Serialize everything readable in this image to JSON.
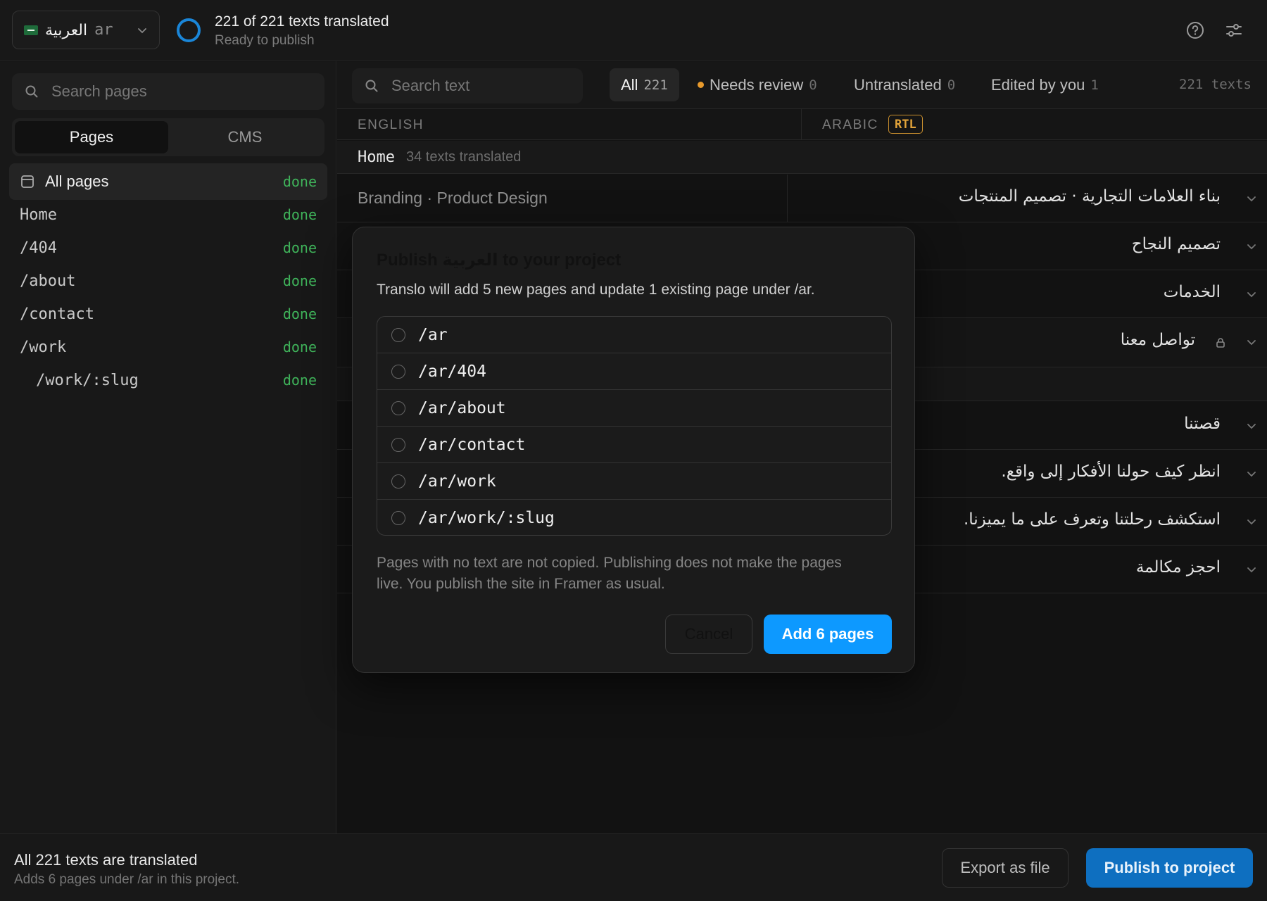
{
  "header": {
    "language_name": "العربية",
    "language_code": "ar",
    "status_title": "221 of 221 texts translated",
    "status_sub": "Ready to publish",
    "icons": [
      "help-icon",
      "settings-sliders-icon"
    ]
  },
  "sidebar": {
    "search_placeholder": "Search pages",
    "tabs": [
      "Pages",
      "CMS"
    ],
    "active_tab": "Pages",
    "items": [
      {
        "label": "All pages",
        "status": "done"
      },
      {
        "label": "Home",
        "status": "done"
      },
      {
        "label": "/404",
        "status": "done"
      },
      {
        "label": "/about",
        "status": "done"
      },
      {
        "label": "/contact",
        "status": "done"
      },
      {
        "label": "/work",
        "status": "done"
      },
      {
        "label": "/work/:slug",
        "status": "done"
      }
    ]
  },
  "filters": {
    "search_placeholder": "Search text",
    "chips": [
      {
        "label": "All",
        "count": "221"
      },
      {
        "label": "Needs review",
        "count": "0"
      },
      {
        "label": "Untranslated",
        "count": "0"
      },
      {
        "label": "Edited by you",
        "count": "1"
      }
    ],
    "total": "221 texts"
  },
  "columns": {
    "source": "ENGLISH",
    "target": "ARABIC",
    "badge": "RTL"
  },
  "section": {
    "name": "Home",
    "meta": "34 texts translated"
  },
  "rows": [
    {
      "source": "Branding · Product Design",
      "target": "بناء العلامات التجارية · تصميم المنتجات"
    },
    {
      "source": "",
      "target": "تصميم النجاح"
    },
    {
      "source": "",
      "target": "الخدمات"
    },
    {
      "source": "",
      "target": "تواصل معنا"
    },
    {
      "source": "",
      "target": "قصتنا"
    },
    {
      "source": "",
      "target": "انظر كيف حولنا الأفكار إلى واقع."
    },
    {
      "source": "",
      "target": "استكشف رحلتنا وتعرف على ما يميزنا."
    },
    {
      "source": "",
      "target": "احجز مكالمة"
    }
  ],
  "modal": {
    "title": "Publish العربية to your project",
    "description": "Translo will add 5 new pages and update 1 existing page under /ar.",
    "routes": [
      "/ar",
      "/ar/404",
      "/ar/about",
      "/ar/contact",
      "/ar/work",
      "/ar/work/:slug"
    ],
    "note": "Pages with no text are not copied. Publishing does not make the pages live. You publish the site in Framer as usual.",
    "cancel_label": "Cancel",
    "confirm_label": "Add 6 pages"
  },
  "footer": {
    "title": "All 221 texts are translated",
    "sub": "Adds 6 pages under /ar in this project.",
    "export_label": "Export as file",
    "publish_label": "Publish to project"
  },
  "colors": {
    "accent": "#0d99ff",
    "done": "#3fb35a",
    "warning": "#e89a2c",
    "rtl_badge": "#e1a33a"
  }
}
